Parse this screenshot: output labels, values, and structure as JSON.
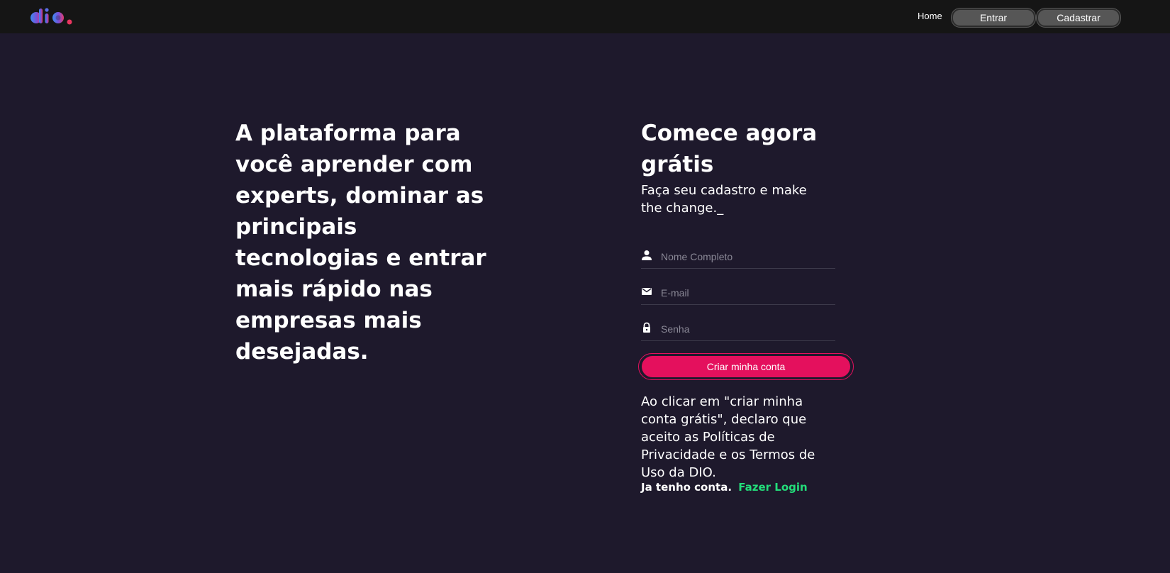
{
  "header": {
    "logo_text": "dio.",
    "nav": {
      "home_label": "Home",
      "entrar_label": "Entrar",
      "cadastrar_label": "Cadastrar"
    }
  },
  "hero": {
    "title": "A plataforma para você aprender com experts, dominar as principais tecnologias e entrar mais rápido nas empresas mais desejadas."
  },
  "signup": {
    "title": "Comece agora grátis",
    "subtitle": "Faça seu cadastro e make the change._",
    "fields": {
      "nome": {
        "placeholder": "Nome Completo",
        "icon": "user-icon"
      },
      "email": {
        "placeholder": "E-mail",
        "icon": "mail-icon"
      },
      "senha": {
        "placeholder": "Senha",
        "icon": "lock-icon"
      }
    },
    "submit_label": "Criar minha conta",
    "terms_text": "Ao clicar em \"criar minha conta grátis\", declaro que aceito as Políticas de Privacidade e os Termos de Uso da DIO.",
    "have_account_text": "Ja tenho conta.",
    "login_link": "Fazer Login"
  },
  "colors": {
    "background": "#1e192c",
    "header": "#151515",
    "accent": "#e4105d",
    "link_green": "#23dd7a",
    "nav_button": "#565656"
  }
}
